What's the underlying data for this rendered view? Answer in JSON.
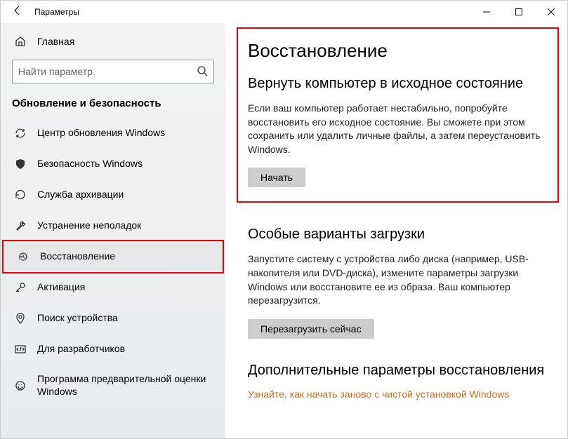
{
  "titlebar": {
    "title": "Параметры"
  },
  "sidebar": {
    "home": "Главная",
    "search_placeholder": "Найти параметр",
    "section": "Обновление и безопасность",
    "items": [
      {
        "label": "Центр обновления Windows"
      },
      {
        "label": "Безопасность Windows"
      },
      {
        "label": "Служба архивации"
      },
      {
        "label": "Устранение неполадок"
      },
      {
        "label": "Восстановление"
      },
      {
        "label": "Активация"
      },
      {
        "label": "Поиск устройства"
      },
      {
        "label": "Для разработчиков"
      },
      {
        "label": "Программа предварительной оценки Windows"
      }
    ]
  },
  "main": {
    "title": "Восстановление",
    "reset": {
      "heading": "Вернуть компьютер в исходное состояние",
      "body": "Если ваш компьютер работает нестабильно, попробуйте восстановить его исходное состояние. Вы сможете при этом сохранить или удалить личные файлы, а затем переустановить Windows.",
      "button": "Начать"
    },
    "startup": {
      "heading": "Особые варианты загрузки",
      "body": "Запустите систему с устройства либо диска (например, USB-накопителя или DVD-диска), измените параметры загрузки Windows или восстановите ее из образа. Ваш компьютер перезагрузится.",
      "button": "Перезагрузить сейчас"
    },
    "more": {
      "heading": "Дополнительные параметры восстановления",
      "link": "Узнайте, как начать заново с чистой установкой Windows"
    }
  }
}
